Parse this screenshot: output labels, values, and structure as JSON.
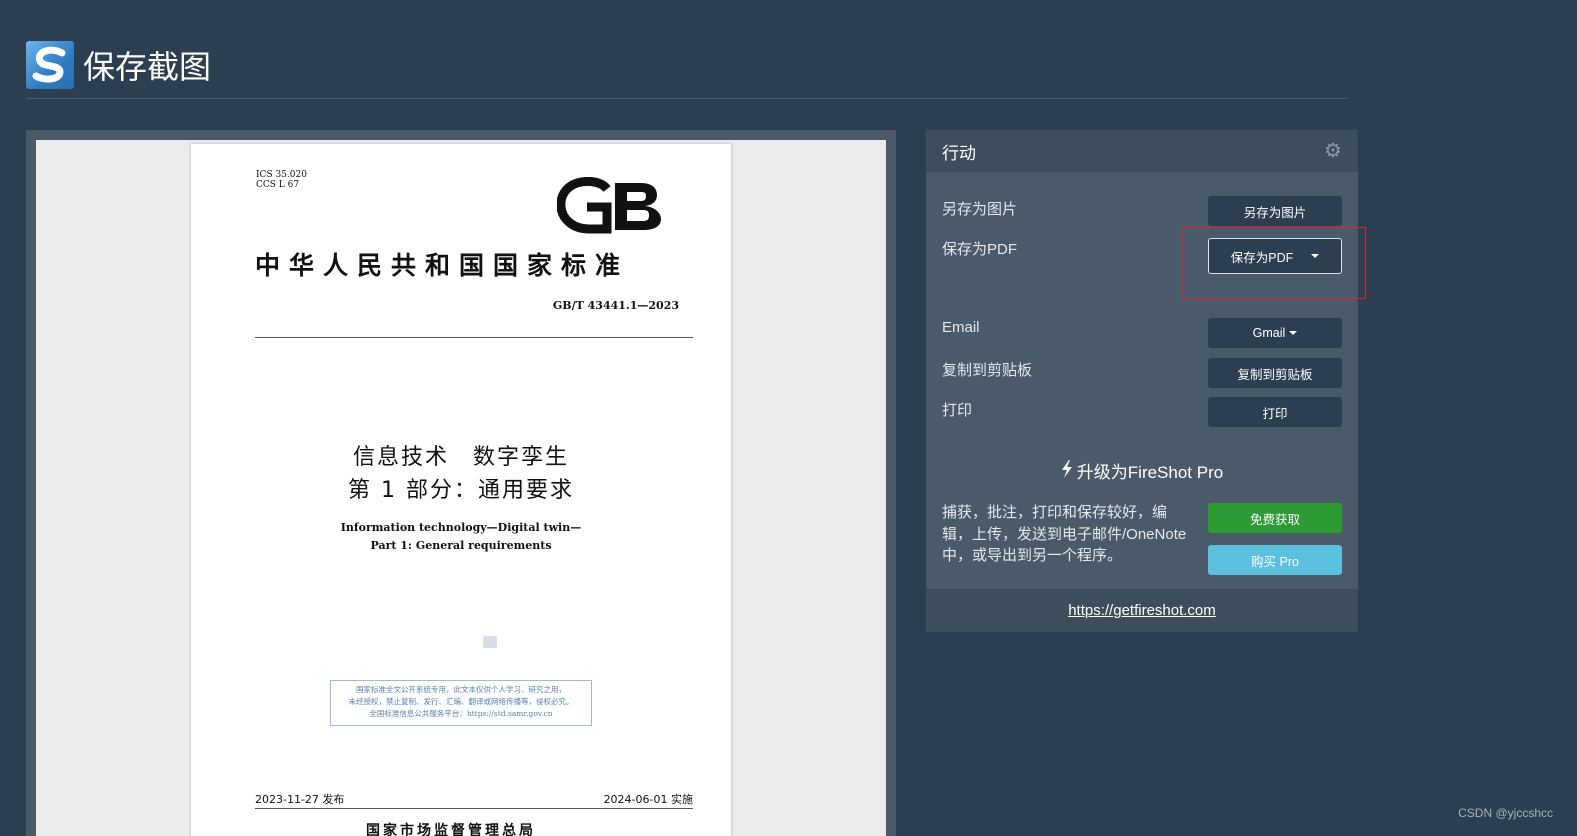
{
  "header": {
    "title": "保存截图",
    "logo_icon": "fireshot-s-logo"
  },
  "document": {
    "ics": "ICS 35.020",
    "ccs": "CCS L 67",
    "gb_mark": "GB",
    "national_standard": "中华人民共和国国家标准",
    "standard_no": "GB/T 43441.1—2023",
    "title_line1": "信息技术　数字孪生",
    "title_line2": "第 1 部分：通用要求",
    "en_line1": "Information technology—Digital twin—",
    "en_line2": "Part 1: General requirements",
    "notice_line1": "国家标准全文公开系统专用，此文本仅供个人学习、研究之用，",
    "notice_line2": "未经授权，禁止复制、发行、汇编、翻译或网络传播等，侵权必究。",
    "notice_line3": "全国标准信息公共服务平台：https://std.samr.gov.cn",
    "release_date": "2023-11-27 发布",
    "implement_date": "2024-06-01 实施",
    "issuer": "国家市场监督管理总局"
  },
  "panel": {
    "title": "行动",
    "settings_icon": "gear-icon",
    "rows": [
      {
        "label": "另存为图片",
        "button": "另存为图片"
      },
      {
        "label": "保存为PDF",
        "button": "保存为PDF"
      },
      {
        "label": "Email",
        "button": "Gmail"
      },
      {
        "label": "复制到剪贴板",
        "button": "复制到剪贴板"
      },
      {
        "label": "打印",
        "button": "打印"
      }
    ],
    "upgrade_text": "升级为FireShot Pro",
    "upgrade_icon": "bolt-icon",
    "description": "捕获，批注，打印和保存较好，编辑，上传，发送到电子邮件/OneNote中，或导出到另一个程序。",
    "free_button": "免费获取",
    "buy_button": "购买 Pro",
    "footer_link": "https://getfireshot.com"
  },
  "watermark": "CSDN @yjccshcc",
  "colors": {
    "background": "#2c3e50",
    "panel": "#4b5a69",
    "green": "#2e9a34",
    "blue": "#5bc0de",
    "highlight": "#e0242b"
  }
}
